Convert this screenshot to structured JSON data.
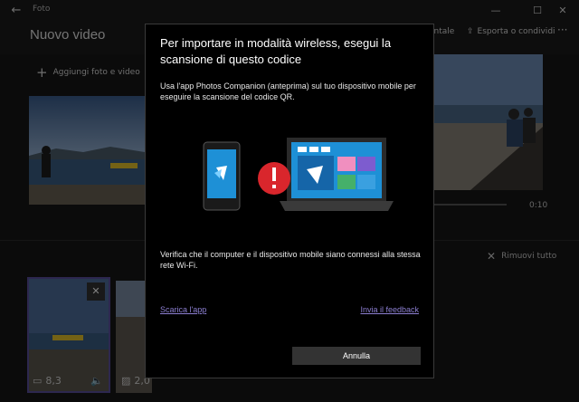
{
  "titlebar": {
    "app_title": "Foto"
  },
  "header": {
    "page_title": "Nuovo video",
    "orientation_label": "ontale",
    "export_label": "Esporta o condividi"
  },
  "toolbar": {
    "add_label": "Aggiungi foto e video"
  },
  "player": {
    "time": "0:10"
  },
  "storyboard": {
    "remove_all_label": "Rimuovi tutto",
    "thumbs": [
      {
        "duration": "8,3"
      },
      {
        "duration": "2,0"
      }
    ]
  },
  "dialog": {
    "title": "Per importare in modalità wireless, esegui la scansione di questo codice",
    "instructions": "Usa l'app Photos Companion (anteprima) sul tuo dispositivo mobile per eseguire la scansione del codice QR.",
    "wifi_note": "Verifica che il computer e il dispositivo mobile siano connessi alla stessa rete Wi-Fi.",
    "download_link": "Scarica l'app",
    "feedback_link": "Invia il feedback",
    "cancel_label": "Annulla"
  },
  "colors": {
    "accent": "#8c7fd1",
    "error": "#d9262c",
    "phone_screen": "#1e90d6"
  }
}
